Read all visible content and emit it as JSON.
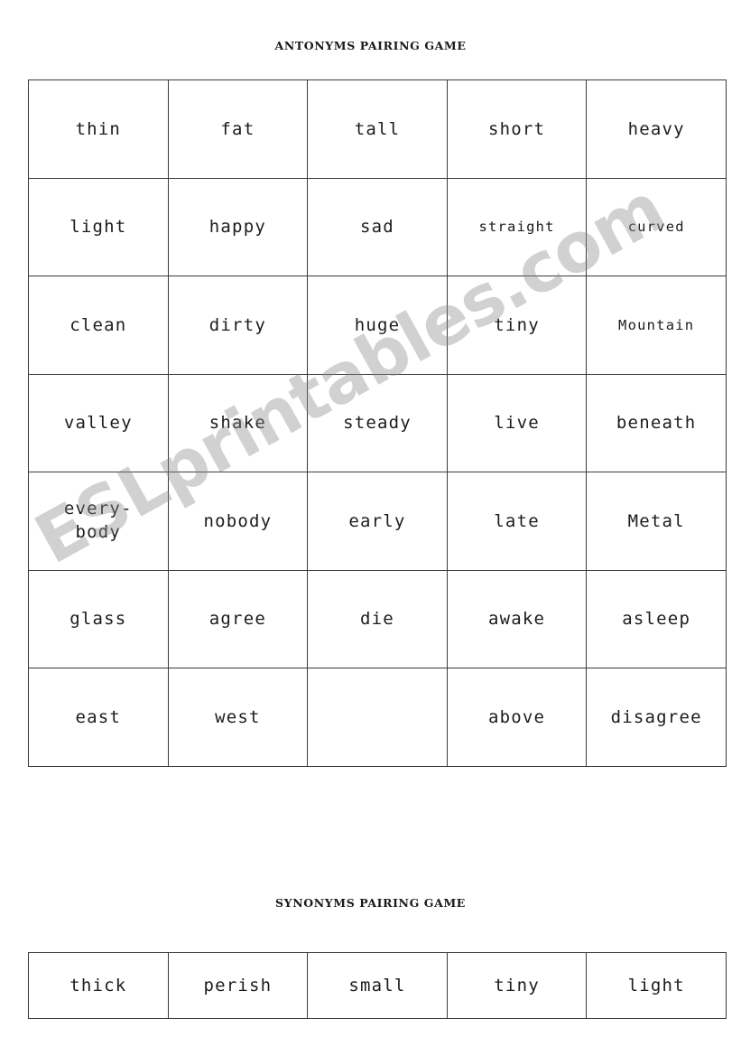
{
  "document": {
    "watermark": "ESLprintables.com",
    "sections": [
      {
        "heading": "ANTONYMS PAIRING GAME",
        "rows": [
          [
            "thin",
            "fat",
            "tall",
            "short",
            "heavy"
          ],
          [
            "light",
            "happy",
            "sad",
            "straight",
            "curved"
          ],
          [
            "clean",
            "dirty",
            "huge",
            "tiny",
            "Mountain"
          ],
          [
            "valley",
            "shake",
            "steady",
            "live",
            "beneath"
          ],
          [
            "every-\nbody",
            "nobody",
            "early",
            "late",
            "Metal"
          ],
          [
            "glass",
            "agree",
            "die",
            "awake",
            "asleep"
          ],
          [
            "east",
            "west",
            "",
            "above",
            "disagree"
          ]
        ]
      },
      {
        "heading": "SYNONYMS PAIRING GAME",
        "rows": [
          [
            "thick",
            "perish",
            "small",
            "tiny",
            "light"
          ]
        ]
      }
    ]
  }
}
